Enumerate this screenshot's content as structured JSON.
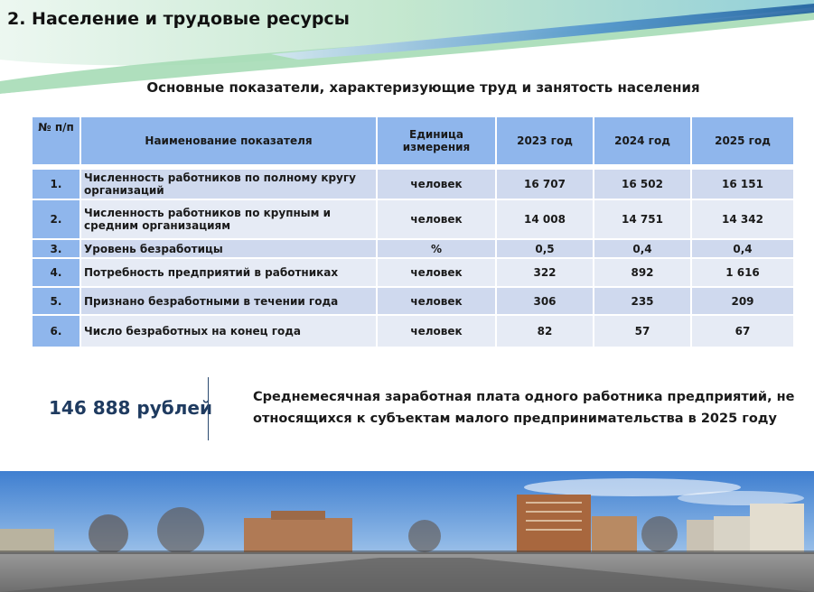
{
  "slide": {
    "title": "2. Население и трудовые ресурсы",
    "caption": "Основные показатели, характеризующие труд и занятость населения"
  },
  "table": {
    "headers": {
      "num": "№ п/п",
      "name": "Наименование показателя",
      "unit": "Единица измерения",
      "y2023": "2023 год",
      "y2024": "2024 год",
      "y2025": "2025 год"
    },
    "rows": [
      {
        "num": "1.",
        "name": "Численность работников по полному кругу организаций",
        "unit": "человек",
        "y2023": "16 707",
        "y2024": "16 502",
        "y2025": "16 151"
      },
      {
        "num": "2.",
        "name": "Численность работников по крупным и средним организациям",
        "unit": "человек",
        "y2023": "14 008",
        "y2024": "14 751",
        "y2025": "14 342"
      },
      {
        "num": "3.",
        "name": "Уровень безработицы",
        "unit": "%",
        "y2023": "0,5",
        "y2024": "0,4",
        "y2025": "0,4"
      },
      {
        "num": "4.",
        "name": "Потребность предприятий в работниках",
        "unit": "человек",
        "y2023": "322",
        "y2024": "892",
        "y2025": "1 616"
      },
      {
        "num": "5.",
        "name": "Признано безработными в течении года",
        "unit": "человек",
        "y2023": "306",
        "y2024": "235",
        "y2025": "209"
      },
      {
        "num": "6.",
        "name": "Число безработных на конец года",
        "unit": "человек",
        "y2023": "82",
        "y2024": "57",
        "y2025": "67"
      }
    ]
  },
  "salary": {
    "value": "146 888 рублей",
    "description_line1": "Среднемесячная заработная плата одного  работника предприятий, не",
    "description_line2": "относящихся к субъектам малого предпринимательства в 2025 году"
  },
  "colors": {
    "header_cell": "#8fb6ec",
    "row_odd": "#cfd9ee",
    "row_even": "#e6ebf5",
    "salary_value": "#1f3b60",
    "swoosh_green": "#9bd3a8",
    "swoosh_blue": "#2f76b8"
  },
  "images": {
    "header": "teal-blue-swoosh",
    "footer": "city-panorama"
  }
}
